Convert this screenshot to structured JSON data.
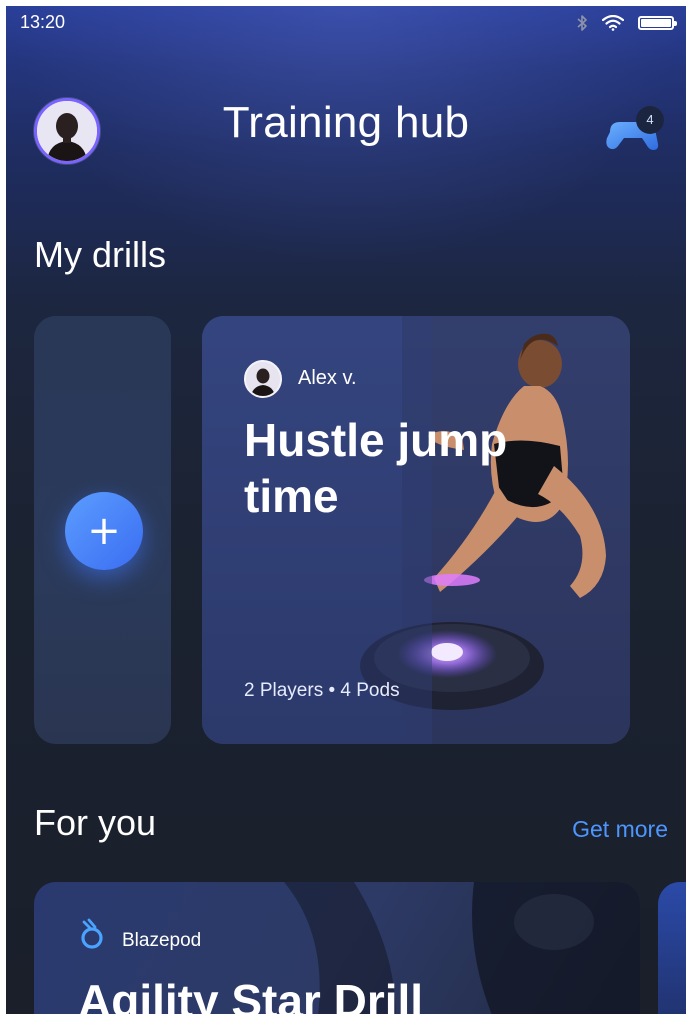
{
  "status_bar": {
    "time": "13:20",
    "icons": [
      "bluetooth-icon",
      "wifi-icon",
      "battery-icon"
    ]
  },
  "header": {
    "title": "Training hub",
    "avatar_icon": "user-avatar",
    "controller_icon": "game-controller-icon",
    "controller_badge": "4"
  },
  "my_drills": {
    "title": "My drills",
    "add_button_label": "+",
    "drill": {
      "author": "Alex v.",
      "title": "Hustle jump time",
      "meta": "2 Players • 4 Pods"
    }
  },
  "for_you": {
    "title": "For you",
    "get_more": "Get more",
    "card": {
      "brand": "Blazepod",
      "brand_icon": "blazepod-logo-icon",
      "title": "Agility Star Drill"
    }
  },
  "colors": {
    "accent": "#4d96ff",
    "avatar_ring": "#7b63ff",
    "background_dark": "#1b2230"
  }
}
